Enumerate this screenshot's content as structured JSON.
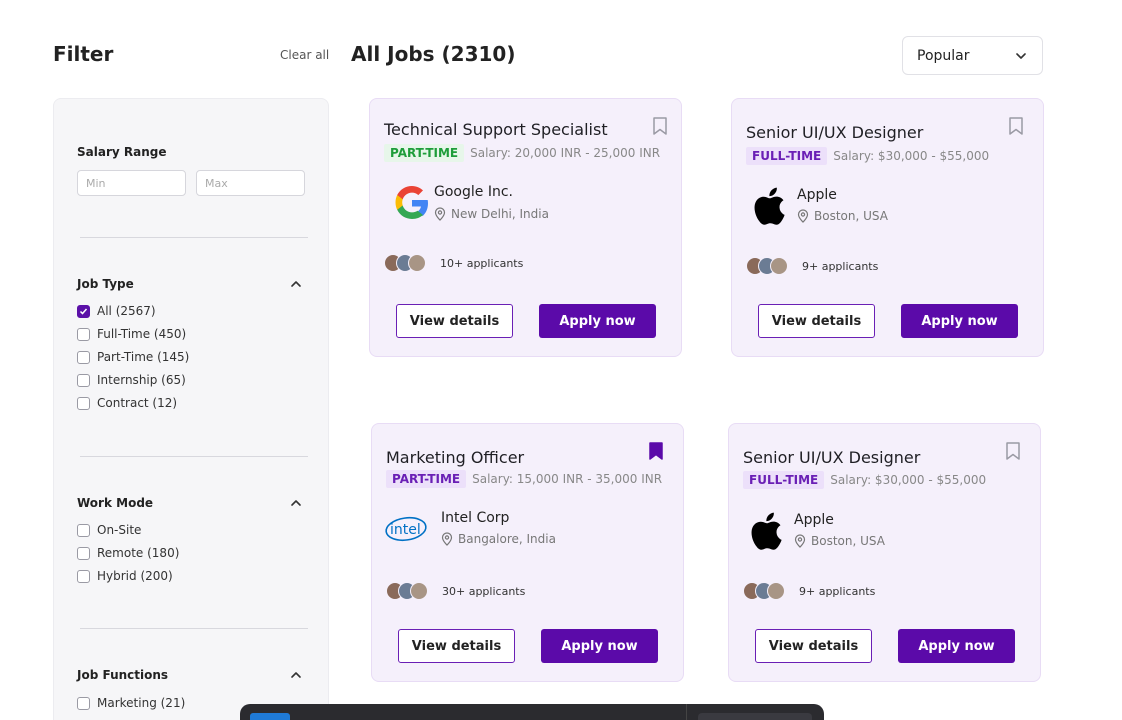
{
  "filter": {
    "title": "Filter",
    "clear_all": "Clear all",
    "salary": {
      "label": "Salary Range",
      "min_placeholder": "Min",
      "max_placeholder": "Max"
    },
    "job_type": {
      "label": "Job Type",
      "options": [
        {
          "label": "All (2567)",
          "checked": true
        },
        {
          "label": "Full-Time (450)",
          "checked": false
        },
        {
          "label": "Part-Time (145)",
          "checked": false
        },
        {
          "label": "Internship (65)",
          "checked": false
        },
        {
          "label": "Contract (12)",
          "checked": false
        }
      ]
    },
    "work_mode": {
      "label": "Work Mode",
      "options": [
        {
          "label": "On-Site",
          "checked": false
        },
        {
          "label": "Remote (180)",
          "checked": false
        },
        {
          "label": "Hybrid (200)",
          "checked": false
        }
      ]
    },
    "job_functions": {
      "label": "Job Functions",
      "options": [
        {
          "label": "Marketing (21)",
          "checked": false
        }
      ]
    }
  },
  "jobs": {
    "title": "All Jobs (2310)",
    "sort": {
      "selected": "Popular"
    },
    "cards": [
      {
        "title": "Technical Support Specialist",
        "tag": "PART-TIME",
        "salary": "Salary: 20,000 INR - 25,000 INR",
        "company": "Google Inc.",
        "location": "New Delhi, India",
        "applicants": "10+ applicants",
        "logo": "google-logo",
        "bookmarked": false,
        "view_label": "View details",
        "apply_label": "Apply now"
      },
      {
        "title": "Senior UI/UX Designer",
        "tag": "FULL-TIME",
        "salary": "Salary: $30,000 - $55,000",
        "company": "Apple",
        "location": "Boston, USA",
        "applicants": "9+ applicants",
        "logo": "apple-logo",
        "bookmarked": false,
        "view_label": "View details",
        "apply_label": "Apply now"
      },
      {
        "title": "Marketing Officer",
        "tag": "PART-TIME",
        "salary": "Salary: 15,000 INR - 35,000 INR",
        "company": "Intel Corp",
        "location": "Bangalore, India",
        "applicants": "30+ applicants",
        "logo": "intel-logo",
        "bookmarked": true,
        "view_label": "View details",
        "apply_label": "Apply now"
      },
      {
        "title": "Senior UI/UX Designer",
        "tag": "FULL-TIME",
        "salary": "Salary: $30,000 - $55,000",
        "company": "Apple",
        "location": "Boston, USA",
        "applicants": "9+ applicants",
        "logo": "apple-logo",
        "bookmarked": false,
        "view_label": "View details",
        "apply_label": "Apply now"
      }
    ]
  },
  "colors": {
    "accent": "#5b0aa9",
    "card_bg": "#f5f0fb",
    "part_time_green": "#1e9d3a"
  }
}
